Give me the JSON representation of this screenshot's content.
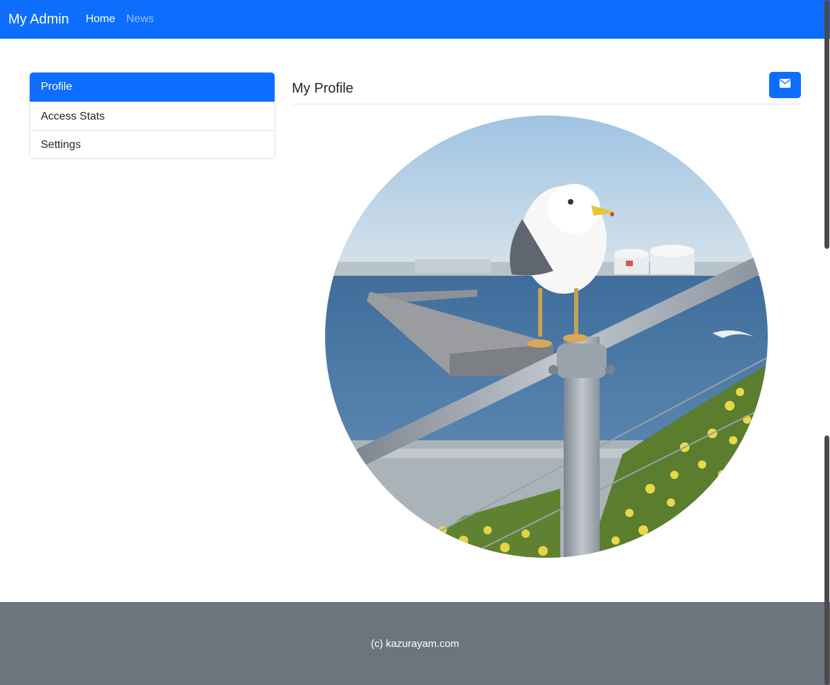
{
  "navbar": {
    "brand": "My Admin",
    "links": [
      {
        "label": "Home",
        "active": true
      },
      {
        "label": "News",
        "active": false
      }
    ]
  },
  "sidebar": {
    "items": [
      {
        "label": "Profile",
        "active": true
      },
      {
        "label": "Access Stats",
        "active": false
      },
      {
        "label": "Settings",
        "active": false
      }
    ]
  },
  "main": {
    "title": "My Profile",
    "mail_button_icon": "envelope-icon",
    "profile_image": "seagull-on-railing-photo"
  },
  "footer": {
    "text": "(c) kazurayam.com"
  },
  "colors": {
    "primary": "#0d6efd",
    "footer_bg": "#6c757d",
    "border": "#dee2e6"
  }
}
